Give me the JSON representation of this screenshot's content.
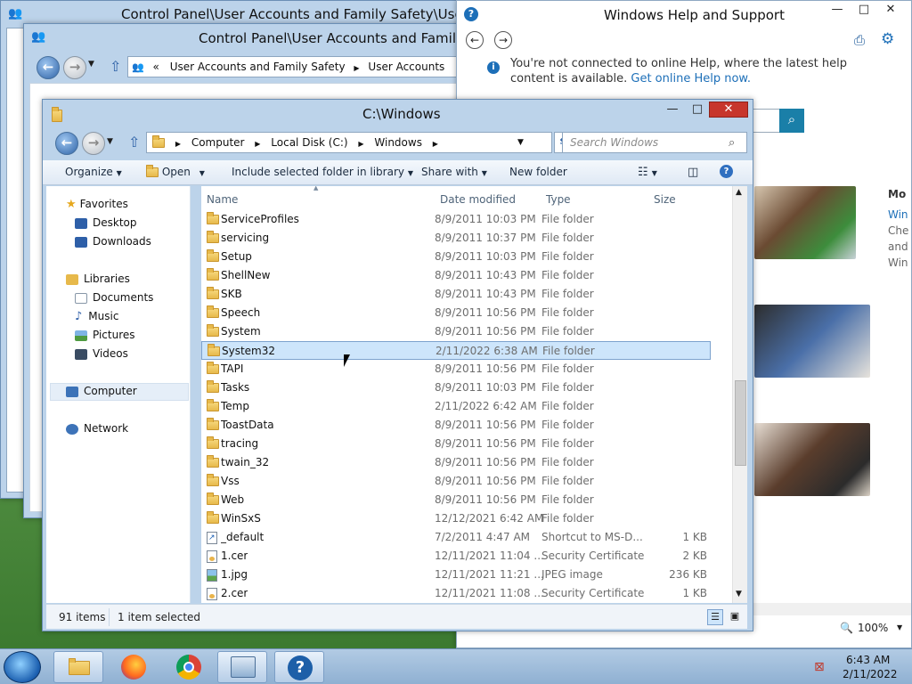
{
  "cp_back": {
    "title": "Control Panel\\User Accounts and Family Safety\\User Acco"
  },
  "cp_front": {
    "title": "Control Panel\\User Accounts and Family Safe",
    "breadcrumb": [
      "«",
      "User Accounts and Family Safety",
      "User Accounts"
    ]
  },
  "help": {
    "title": "Windows Help and Support",
    "notice_text": "You're not connected to online Help, where the latest help content is available.",
    "notice_link": "Get online Help now.",
    "side_texts": [
      "Mo",
      "Win",
      "Che",
      "and",
      "Win"
    ],
    "zoom": "100%"
  },
  "explorer": {
    "title": "C:\\Windows",
    "path": [
      "Computer",
      "Local Disk (C:)",
      "Windows"
    ],
    "search_placeholder": "Search Windows",
    "toolbar": {
      "organize": "Organize",
      "open": "Open",
      "include": "Include selected folder in library",
      "share": "Share with",
      "new_folder": "New folder"
    },
    "nav": {
      "favorites": "Favorites",
      "desktop": "Desktop",
      "downloads": "Downloads",
      "libraries": "Libraries",
      "documents": "Documents",
      "music": "Music",
      "pictures": "Pictures",
      "videos": "Videos",
      "computer": "Computer",
      "network": "Network"
    },
    "columns": {
      "name": "Name",
      "date": "Date modified",
      "type": "Type",
      "size": "Size"
    },
    "files": [
      {
        "name": "ServiceProfiles",
        "date": "8/9/2011 10:03 PM",
        "type": "File folder",
        "size": "",
        "icon": "folder-icon"
      },
      {
        "name": "servicing",
        "date": "8/9/2011 10:37 PM",
        "type": "File folder",
        "size": "",
        "icon": "folder-icon"
      },
      {
        "name": "Setup",
        "date": "8/9/2011 10:03 PM",
        "type": "File folder",
        "size": "",
        "icon": "folder-icon"
      },
      {
        "name": "ShellNew",
        "date": "8/9/2011 10:43 PM",
        "type": "File folder",
        "size": "",
        "icon": "folder-icon"
      },
      {
        "name": "SKB",
        "date": "8/9/2011 10:43 PM",
        "type": "File folder",
        "size": "",
        "icon": "folder-icon"
      },
      {
        "name": "Speech",
        "date": "8/9/2011 10:56 PM",
        "type": "File folder",
        "size": "",
        "icon": "folder-icon"
      },
      {
        "name": "System",
        "date": "8/9/2011 10:56 PM",
        "type": "File folder",
        "size": "",
        "icon": "folder-icon"
      },
      {
        "name": "System32",
        "date": "2/11/2022 6:38 AM",
        "type": "File folder",
        "size": "",
        "icon": "folder-icon",
        "selected": true
      },
      {
        "name": "TAPI",
        "date": "8/9/2011 10:56 PM",
        "type": "File folder",
        "size": "",
        "icon": "folder-icon"
      },
      {
        "name": "Tasks",
        "date": "8/9/2011 10:03 PM",
        "type": "File folder",
        "size": "",
        "icon": "folder-icon"
      },
      {
        "name": "Temp",
        "date": "2/11/2022 6:42 AM",
        "type": "File folder",
        "size": "",
        "icon": "folder-icon"
      },
      {
        "name": "ToastData",
        "date": "8/9/2011 10:56 PM",
        "type": "File folder",
        "size": "",
        "icon": "folder-icon"
      },
      {
        "name": "tracing",
        "date": "8/9/2011 10:56 PM",
        "type": "File folder",
        "size": "",
        "icon": "folder-icon"
      },
      {
        "name": "twain_32",
        "date": "8/9/2011 10:56 PM",
        "type": "File folder",
        "size": "",
        "icon": "folder-icon"
      },
      {
        "name": "Vss",
        "date": "8/9/2011 10:56 PM",
        "type": "File folder",
        "size": "",
        "icon": "folder-icon"
      },
      {
        "name": "Web",
        "date": "8/9/2011 10:56 PM",
        "type": "File folder",
        "size": "",
        "icon": "folder-icon"
      },
      {
        "name": "WinSxS",
        "date": "12/12/2021 6:42 AM",
        "type": "File folder",
        "size": "",
        "icon": "folder-icon"
      },
      {
        "name": "_default",
        "date": "7/2/2011 4:47 AM",
        "type": "Shortcut to MS-D...",
        "size": "1 KB",
        "icon": "shortcut-icon"
      },
      {
        "name": "1.cer",
        "date": "12/11/2021 11:04 ...",
        "type": "Security Certificate",
        "size": "2 KB",
        "icon": "certificate-icon"
      },
      {
        "name": "1.jpg",
        "date": "12/11/2021 11:21 ...",
        "type": "JPEG image",
        "size": "236 KB",
        "icon": "image-file-icon"
      },
      {
        "name": "2.cer",
        "date": "12/11/2021 11:08 ...",
        "type": "Security Certificate",
        "size": "1 KB",
        "icon": "certificate-icon"
      }
    ],
    "status": {
      "count": "91 items",
      "selected": "1 item selected"
    }
  },
  "taskbar": {
    "time": "6:43 AM",
    "date": "2/11/2022"
  }
}
